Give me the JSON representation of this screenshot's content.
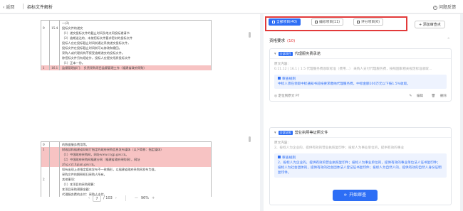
{
  "topbar": {
    "back_label": "返回",
    "title": "招标文件解析",
    "feedback_label": "问题反馈"
  },
  "doc": {
    "page_rows_top": [
      {
        "c1": "",
        "c2": "",
        "c3": "一(2)",
        "hl": false
      },
      {
        "c1": "9",
        "c2": "15.4",
        "c3": "投标文件的递交",
        "hl": false
      },
      {
        "c1": "",
        "c2": "",
        "c3": "（1）递交投标文件的截止时间及地点同投标邀请书",
        "hl": false
      },
      {
        "c1": "",
        "c2": "",
        "c3": "（2）逾期送达的、未按招标文件要求密封的投标文件",
        "hl": false
      },
      {
        "c1": "",
        "c2": "",
        "c3": "投标人应在投标截止时间前通过系统递交投标文件，",
        "hl": false
      },
      {
        "c1": "",
        "c2": "",
        "c3": "投标文件在投标截止时间前可以修改和撤回。",
        "hl": false
      },
      {
        "c1": "",
        "c2": "",
        "c3": "采购人或代理机构不接受逾期递交的投标文件。",
        "hl": false
      },
      {
        "c1": "",
        "c2": "",
        "c3": "除招标文件另有规定外，投标人应提交纸质投标文件",
        "hl": false
      },
      {
        "c1": "",
        "c2": "",
        "c3": "（1）正本一份。",
        "hl": false
      },
      {
        "c1": "1",
        "c2": "16.1",
        "c3": "监督管理部门：  负责采购项目监督管理工作（福建省政府采购）",
        "hl": true
      }
    ],
    "page_rows_bottom": [
      {
        "c1": "0",
        "c2": "",
        "c3": "的数据服务费用等。",
        "hl": false
      },
      {
        "c1": "1",
        "c2": "",
        "c3": "财政部和福建省财政厅指定的政府采购信息发布媒体（以下简称：指定媒体）",
        "hl": true
      },
      {
        "c1": "",
        "c2": "",
        "c3": "（1）中国政府采购网，网址www.ccgp.gov.cn。",
        "hl": true
      },
      {
        "c1": "",
        "c2": "",
        "c3": "（2）中国政府采购网福建分网（福建省政府采购网），网址",
        "hl": true
      },
      {
        "c1": "",
        "c2": "",
        "c3": "zfcg.czt.fujian.gov.cn。",
        "hl": true
      },
      {
        "c1": "",
        "c2": "",
        "c3": "如有出现上述指定媒体发布不一致情形，以福建省政府采购网发布为准。",
        "hl": false
      },
      {
        "c1": "",
        "c2": "",
        "c3": "采购文件的解释权归采购人所有。",
        "hl": false
      },
      {
        "c1": "2",
        "c2": "",
        "c3": "其他事项：",
        "hl": false
      },
      {
        "c1": "",
        "c2": "",
        "c3": "（1）本项目的采购预算：",
        "hl": false
      },
      {
        "c1": "",
        "c2": "",
        "c3": "本项目采购预算金额：",
        "hl": false
      },
      {
        "c1": "",
        "c2": "",
        "c3": "代理服务费的支付：采购人支付。",
        "hl": false
      }
    ]
  },
  "pager": {
    "prev": "‹",
    "current_page": "7",
    "total": "/ 103",
    "next": "›",
    "zoom_out": "—",
    "zoom": "96%",
    "zoom_in": "+"
  },
  "tabs": [
    {
      "label": "全部项目(40)",
      "active": true
    },
    {
      "label": "编标项目(11)",
      "active": false
    },
    {
      "label": "评分项目(6)",
      "active": false
    }
  ],
  "add_button": "+ 添加审查点",
  "section": {
    "title": "资格要求",
    "count": "(10)",
    "arrow": "⌃"
  },
  "cards": [
    {
      "badge": "全部项目",
      "title": "代理服务费承诺",
      "source_label": "原文内容:",
      "source_text": "0.11.12 | 16.1 | 1.5 代理服务费收取标准（费用…）  采购人支付代理服务费，按照国家相关规定标准收取…",
      "advice_title": "审查规则",
      "advice_text": "中标人须在领取中标通知书前按要求缴纳代理服务费，中标金额100万元以下按1.5%收取。",
      "locate": "定位到原文 P7",
      "edit": "编辑",
      "delete": "删除"
    },
    {
      "badge": "全部证照",
      "title": "营业执照等证照文件",
      "source_label": "原文内容:",
      "source_text": "2、投标人为企业的，提供有效的营业执照复印件；投标人为事业单位的，提供有效的事业",
      "advice_title": "审查规则",
      "advice_text": "2、投标人为企业的，提供有效的营业执照复印件；投标人为事业单位的，提供有效的事业单位法人证书复印件；投标人为社会团体的，提供有效的社会团体法人登记证书复印件；投标人为自然人的，提供有效的自然人身份证明复印件。",
      "locate": "",
      "edit": "",
      "delete": ""
    }
  ],
  "start_button": "开始审查",
  "colors": {
    "accent": "#2d6ef5",
    "highlight": "#f7c3c3",
    "annotation_box": "#e23a3a"
  }
}
